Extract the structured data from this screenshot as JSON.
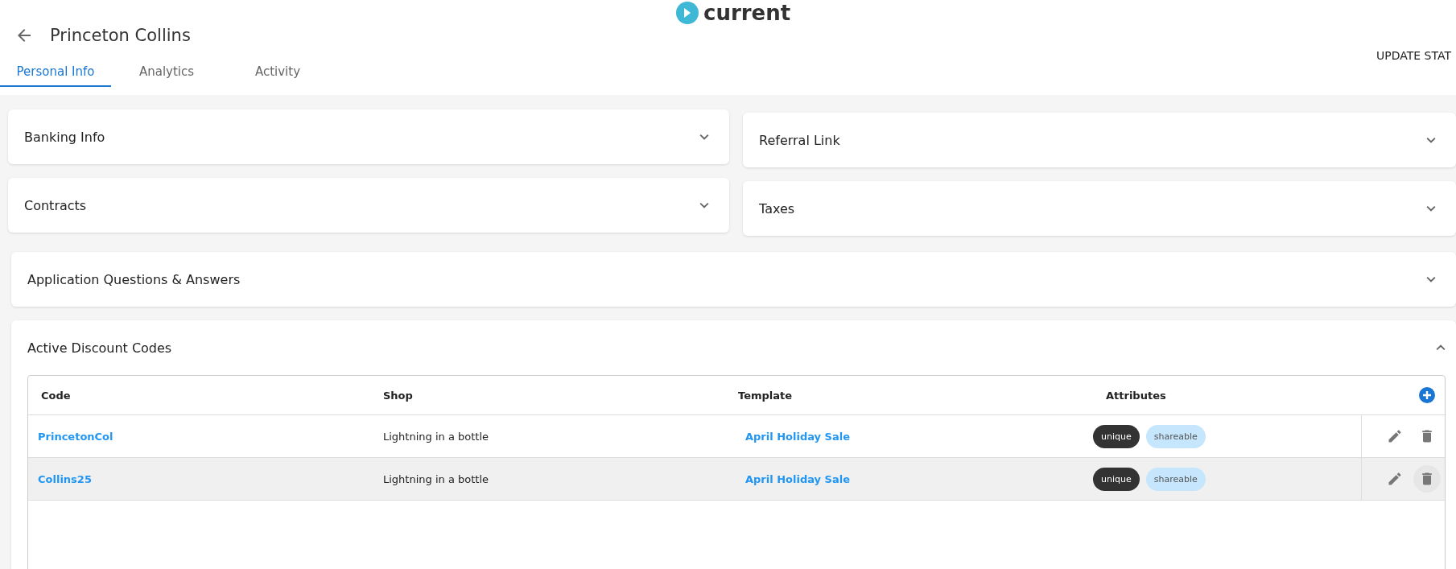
{
  "logo": {
    "text": "current"
  },
  "header": {
    "title": "Princeton Collins",
    "action": "UPDATE STAT"
  },
  "tabs": [
    {
      "label": "Personal Info",
      "selected": true
    },
    {
      "label": "Analytics",
      "selected": false
    },
    {
      "label": "Activity",
      "selected": false
    }
  ],
  "left_sections": [
    {
      "title": "Banking Info",
      "expanded": false
    },
    {
      "title": "Contracts",
      "expanded": false
    }
  ],
  "right_sections": [
    {
      "title": "Referral Link",
      "expanded": false
    },
    {
      "title": "Taxes",
      "expanded": false
    }
  ],
  "questions_section": {
    "title": "Application Questions & Answers",
    "expanded": false
  },
  "discount_section": {
    "title": "Active Discount Codes",
    "expanded": true,
    "table": {
      "columns": [
        "Code",
        "Shop",
        "Template",
        "Attributes"
      ],
      "rows": [
        {
          "code": "PrincetonCol",
          "shop": "Lightning in a bottle",
          "template": "April Holiday Sale",
          "attributes": [
            {
              "label": "unique",
              "kind": "dark"
            },
            {
              "label": "shareable",
              "kind": "light"
            }
          ],
          "hovered": false
        },
        {
          "code": "Collins25",
          "shop": "Lightning in a bottle",
          "template": "April Holiday Sale",
          "attributes": [
            {
              "label": "unique",
              "kind": "dark"
            },
            {
              "label": "shareable",
              "kind": "light"
            }
          ],
          "hovered": true
        }
      ]
    }
  }
}
